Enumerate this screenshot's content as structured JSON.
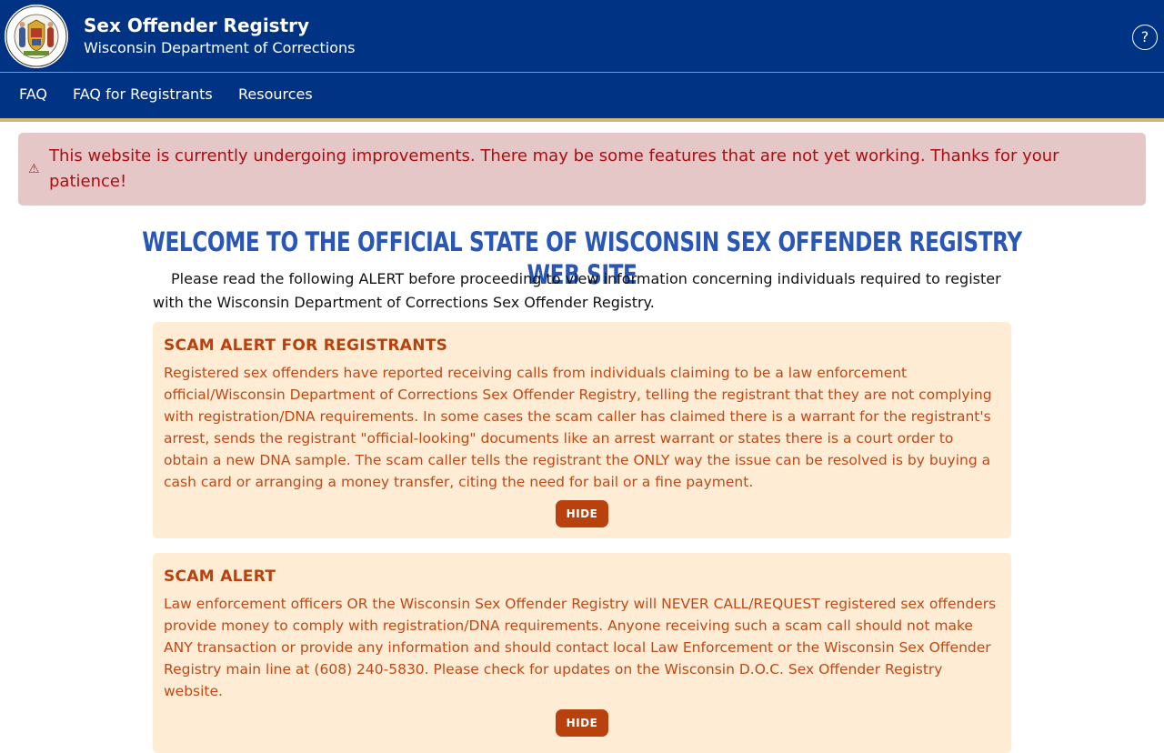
{
  "header": {
    "title": "Sex Offender Registry",
    "subtitle": "Wisconsin Department of Corrections",
    "help_label": "?",
    "seal_text": "STATE OF WISCONSIN · DEPARTMENT OF CORRECTIONS"
  },
  "nav": {
    "items": [
      {
        "label": "FAQ"
      },
      {
        "label": "FAQ for Registrants"
      },
      {
        "label": "Resources"
      }
    ]
  },
  "banner": {
    "icon": "warning-icon",
    "text": "This website is currently undergoing improvements. There may be some features that are not yet working. Thanks for your patience!"
  },
  "main": {
    "welcome": "WELCOME TO THE OFFICIAL STATE OF WISCONSIN SEX OFFENDER REGISTRY WEB SITE",
    "intro": "Please read the following ALERT before proceeding to view information concerning individuals required to register with the Wisconsin Department of Corrections Sex Offender Registry.",
    "alerts": [
      {
        "title": "SCAM ALERT FOR REGISTRANTS",
        "body": "Registered sex offenders have reported receiving calls from individuals claiming to be a law enforcement official/Wisconsin Department of Corrections Sex Offender Registry, telling the registrant that they are not complying with registration/DNA requirements. In some cases the scam caller has claimed there is a warrant for the registrant's arrest, sends the registrant \"official-looking\" documents like an arrest warrant or states there is a court order to obtain a new DNA sample. The scam caller tells the registrant the ONLY way the issue can be resolved is by buying a cash card or arranging a money transfer, citing the need for bail or a fine payment.",
        "button": "HIDE"
      },
      {
        "title": "SCAM ALERT",
        "body": "Law enforcement officers OR the Wisconsin Sex Offender Registry will NEVER CALL/REQUEST registered sex offenders provide money to comply with registration/DNA requirements. Anyone receiving such a scam call should not make ANY transaction or provide any information and should contact local Law Enforcement or the Wisconsin Sex Offender Registry main line at (608) 240-5830. Please check for updates on the Wisconsin D.O.C. Sex Offender Registry website.",
        "button": "HIDE"
      }
    ]
  },
  "colors": {
    "header_bg": "#003383",
    "nav_accent": "#d3b87a",
    "banner_bg": "#e6c7c7",
    "banner_text": "#a80e10",
    "welcome_text": "#2a56b5",
    "alert_bg": "#feecd5",
    "alert_text": "#c24815",
    "button_bg": "#b9410e"
  }
}
